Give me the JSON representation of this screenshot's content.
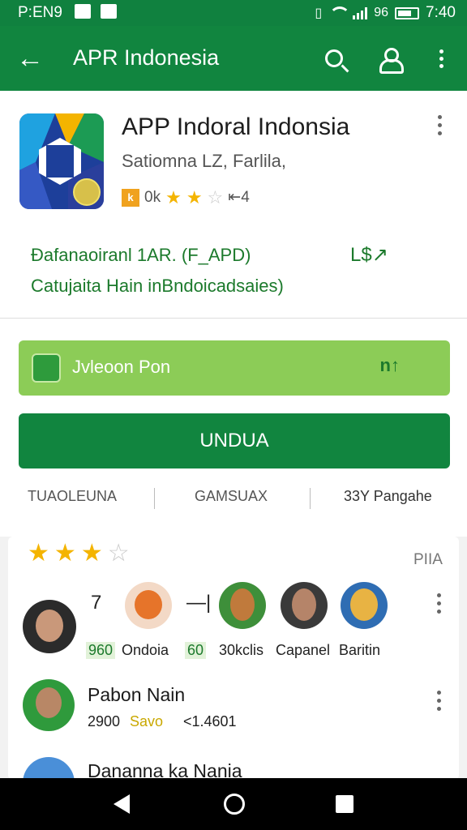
{
  "status_bar": {
    "left_text": "P:EN9",
    "battery_text": "96",
    "time": "7:40"
  },
  "toolbar": {
    "title": "APR Indonesia",
    "icons": [
      "back-arrow-icon",
      "search-icon",
      "account-icon",
      "more-vert-icon"
    ]
  },
  "app": {
    "name": "APP Indoral Indonsia",
    "publisher": "Satiomna LZ, Farlila,",
    "rating_badge": "k",
    "rating_text": "0k",
    "rating_stars": 2.5,
    "downloads_text": "⇤4"
  },
  "description": {
    "line1": "Đafanaoiranl 1AR. (F_APD)",
    "line2": "Catujaita Hain inBndoicadsaies)",
    "share_label": "L$"
  },
  "promo": {
    "text": "Jvleoon Pon",
    "action": "n↑"
  },
  "install_button": "UNDUA",
  "tabs": [
    "TUAOLEUNA",
    "GAMSUAX",
    "33Y Pangahe"
  ],
  "reviews": {
    "stars": 3,
    "label": "PIIA",
    "row1": {
      "labels": [
        "7",
        "—|",
        "960",
        "Ondoia",
        "60",
        "30kclis",
        "Capanel",
        "Baritin"
      ]
    },
    "row2": {
      "name": "Pabon Nain",
      "count": "2900",
      "tag": "Savo",
      "value": "<1.4601"
    },
    "row3": {
      "name": "Dananna ka Nania"
    }
  },
  "colors": {
    "primary_green": "#11853f",
    "light_green": "#8ccc57",
    "star_yellow": "#f4b400"
  }
}
